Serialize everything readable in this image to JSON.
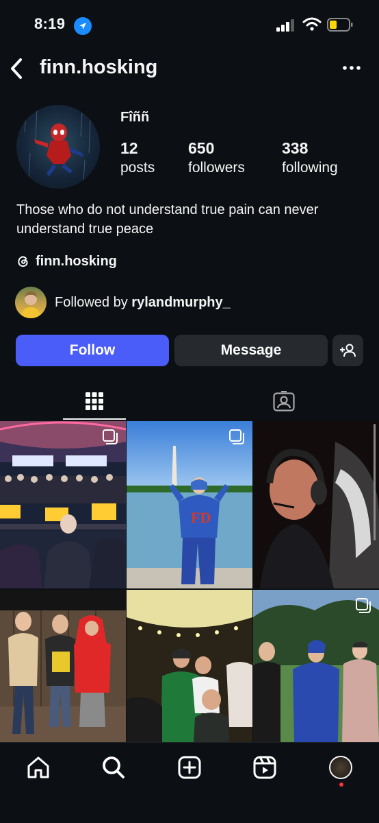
{
  "status": {
    "time": "8:19"
  },
  "header": {
    "username": "finn.hosking"
  },
  "profile": {
    "display_name": "Fîññ",
    "posts_count": "12",
    "posts_label": "posts",
    "followers_count": "650",
    "followers_label": "followers",
    "following_count": "338",
    "following_label": "following",
    "bio": "Those who do not understand true pain can never understand true peace",
    "threads_handle": "finn.hosking",
    "followed_by_prefix": "Followed by ",
    "followed_by_user": "rylandmurphy_"
  },
  "actions": {
    "follow_label": "Follow",
    "message_label": "Message"
  },
  "colors": {
    "background": "#0c1014",
    "accent": "#4a5df9",
    "button": "#262a2f",
    "notification": "#ff3040"
  },
  "icons": {
    "status": [
      "location-arrow-icon",
      "signal-icon",
      "wifi-icon",
      "battery-icon"
    ],
    "header": [
      "back-chevron-icon",
      "more-options-icon"
    ],
    "tabs": [
      "grid-icon",
      "tagged-icon"
    ],
    "nav": [
      "home-icon",
      "search-icon",
      "create-icon",
      "reels-icon",
      "profile-avatar"
    ]
  },
  "grid_posts": [
    {
      "name": "post-gaming-arena",
      "multi": true
    },
    {
      "name": "post-washington-monument",
      "multi": true
    },
    {
      "name": "post-headset-portrait",
      "multi": false
    },
    {
      "name": "post-backyard-friends",
      "multi": false
    },
    {
      "name": "post-tent-party",
      "multi": false
    },
    {
      "name": "post-golf-course-group",
      "multi": true
    }
  ]
}
